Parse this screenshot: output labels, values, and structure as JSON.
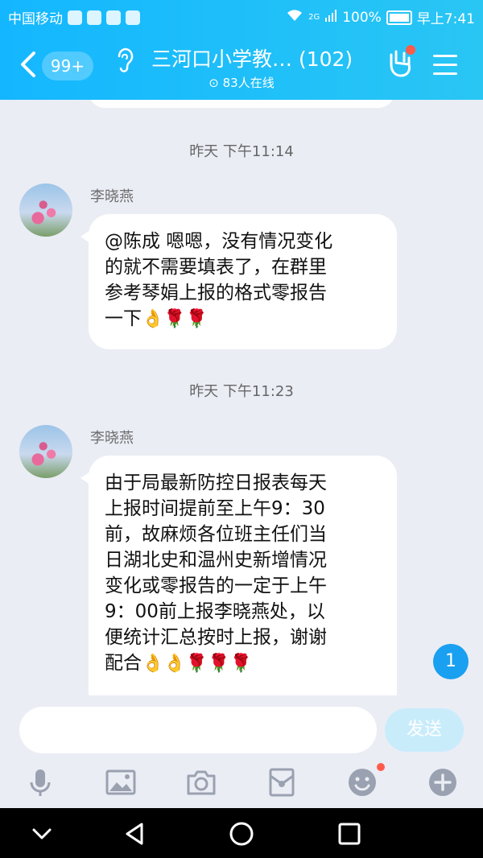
{
  "status_bar": {
    "carrier": "中国移动",
    "network": "2G",
    "battery": "100%",
    "time": "早上7:41"
  },
  "header": {
    "back_badge": "99+",
    "title": "三河口小学教… (102)",
    "online": "83人在线"
  },
  "messages": [
    {
      "timestamp": "昨天 下午11:14",
      "sender": "李晓燕",
      "lines": [
        "@陈成 嗯嗯，没有情况变化",
        "的就不需要填表了，在群里",
        "参考琴娟上报的格式零报告",
        "一下"
      ],
      "emoji": "👌🌹🌹"
    },
    {
      "timestamp": "昨天 下午11:23",
      "sender": "李晓燕",
      "lines": [
        "由于局最新防控日报表每天",
        "上报时间提前至上午9：30",
        "前，故麻烦各位班主任们当",
        "日湖北史和温州史新增情况",
        "变化或零报告的一定于上午",
        "9：00前上报李晓燕处，以",
        "便统计汇总按时上报，谢谢",
        "配合"
      ],
      "emoji": "👌👌🌹🌹🌹"
    }
  ],
  "unread_count": "1",
  "input": {
    "placeholder": "",
    "send_label": "发送"
  },
  "toolbar_icons": [
    "microphone-icon",
    "image-icon",
    "camera-icon",
    "red-packet-icon",
    "emoji-icon",
    "plus-icon"
  ],
  "colors": {
    "header_start": "#14b7ff",
    "header_end": "#29c6f4",
    "chat_bg": "#ebedf5",
    "unread_badge": "#1aa0f0",
    "send_button": "#c9ecfb"
  }
}
